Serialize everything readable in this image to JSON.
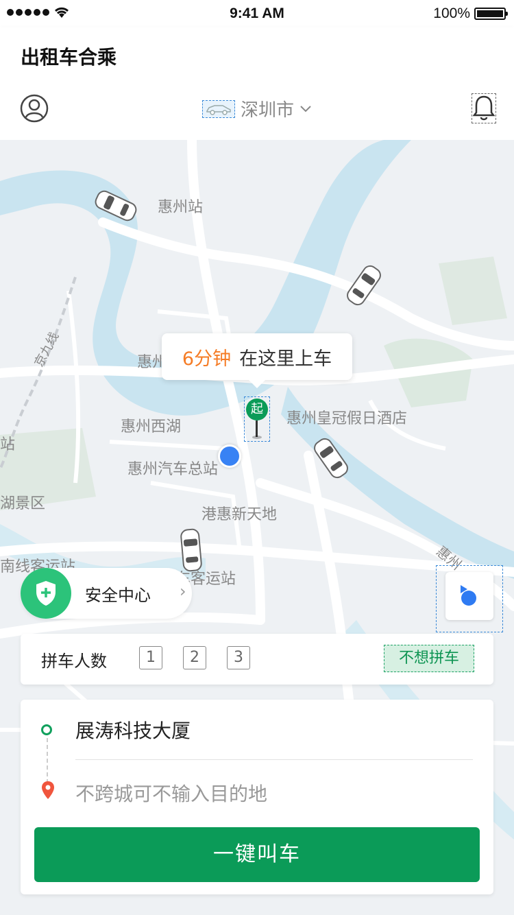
{
  "status_bar": {
    "time": "9:41 AM",
    "battery": "100%"
  },
  "header": {
    "app_title": "出租车合乘",
    "city": "深圳市"
  },
  "map": {
    "labels": [
      "惠州站",
      "惠州",
      "惠州西湖",
      "惠州汽车总站",
      "惠州皇冠假日酒店",
      "港惠新天地",
      "南线客运站",
      "汽车客运站",
      "湖景区",
      "京九线",
      "站",
      "惠州"
    ],
    "tooltip": {
      "eta": "6分钟",
      "text": "在这里上车"
    },
    "start_marker": "起"
  },
  "safety_center": {
    "label": "安全中心"
  },
  "carpool": {
    "title": "拼车人数",
    "options": [
      "1",
      "2",
      "3"
    ],
    "no_carpool": "不想拼车"
  },
  "route": {
    "from": "展涛科技大厦",
    "to_placeholder": "不跨城可不输入目的地"
  },
  "call_button": "一键叫车",
  "colors": {
    "brand_green": "#0b9b58",
    "eta_orange": "#f57c26",
    "location_blue": "#3882f4"
  },
  "icons": [
    "signal-icon",
    "wifi-icon",
    "battery-icon",
    "user-icon",
    "car-icon",
    "chevron-down-icon",
    "bell-icon",
    "shield-icon",
    "chevron-right-icon",
    "locate-icon",
    "destination-pin-icon"
  ]
}
